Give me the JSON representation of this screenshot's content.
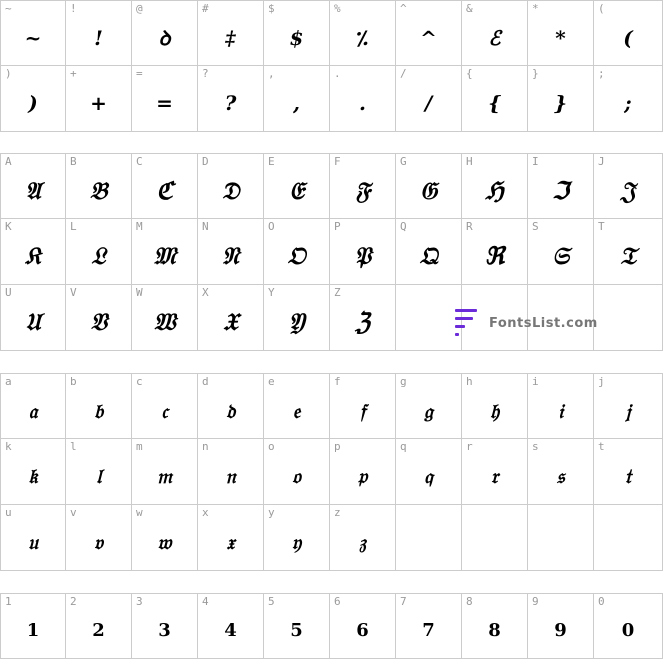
{
  "sections": [
    {
      "id": "symbols",
      "rows": [
        [
          {
            "k": "~",
            "g": "~"
          },
          {
            "k": "!",
            "g": "!"
          },
          {
            "k": "@",
            "g": "ꝺ"
          },
          {
            "k": "#",
            "g": "‡"
          },
          {
            "k": "$",
            "g": "$"
          },
          {
            "k": "%",
            "g": "⁒"
          },
          {
            "k": "^",
            "g": "^"
          },
          {
            "k": "&",
            "g": "ℰ"
          },
          {
            "k": "*",
            "g": "*"
          },
          {
            "k": "(",
            "g": "("
          }
        ],
        [
          {
            "k": ")",
            "g": ")"
          },
          {
            "k": "+",
            "g": "+"
          },
          {
            "k": "=",
            "g": "="
          },
          {
            "k": "?",
            "g": "?"
          },
          {
            "k": ",",
            "g": ","
          },
          {
            "k": ".",
            "g": "."
          },
          {
            "k": "/",
            "g": "/"
          },
          {
            "k": "{",
            "g": "{"
          },
          {
            "k": "}",
            "g": "}"
          },
          {
            "k": ";",
            "g": ";"
          }
        ]
      ]
    },
    {
      "id": "uppercase",
      "rows": [
        [
          {
            "k": "A",
            "g": "𝔄"
          },
          {
            "k": "B",
            "g": "𝔅"
          },
          {
            "k": "C",
            "g": "ℭ"
          },
          {
            "k": "D",
            "g": "𝔇"
          },
          {
            "k": "E",
            "g": "𝔈"
          },
          {
            "k": "F",
            "g": "𝔉"
          },
          {
            "k": "G",
            "g": "𝔊"
          },
          {
            "k": "H",
            "g": "ℌ"
          },
          {
            "k": "I",
            "g": "ℑ"
          },
          {
            "k": "J",
            "g": "𝔍"
          }
        ],
        [
          {
            "k": "K",
            "g": "𝔎"
          },
          {
            "k": "L",
            "g": "𝔏"
          },
          {
            "k": "M",
            "g": "𝔐"
          },
          {
            "k": "N",
            "g": "𝔑"
          },
          {
            "k": "O",
            "g": "𝔒"
          },
          {
            "k": "P",
            "g": "𝔓"
          },
          {
            "k": "Q",
            "g": "𝔔"
          },
          {
            "k": "R",
            "g": "ℜ"
          },
          {
            "k": "S",
            "g": "𝔖"
          },
          {
            "k": "T",
            "g": "𝔗"
          }
        ],
        [
          {
            "k": "U",
            "g": "𝔘"
          },
          {
            "k": "V",
            "g": "𝔙"
          },
          {
            "k": "W",
            "g": "𝔚"
          },
          {
            "k": "X",
            "g": "𝔛"
          },
          {
            "k": "Y",
            "g": "𝔜"
          },
          {
            "k": "Z",
            "g": "ℨ"
          },
          {
            "k": "",
            "g": ""
          },
          {
            "k": "",
            "g": ""
          },
          {
            "k": "",
            "g": ""
          },
          {
            "k": "",
            "g": ""
          }
        ]
      ]
    },
    {
      "id": "lowercase",
      "rows": [
        [
          {
            "k": "a",
            "g": "𝔞"
          },
          {
            "k": "b",
            "g": "𝔟"
          },
          {
            "k": "c",
            "g": "𝔠"
          },
          {
            "k": "d",
            "g": "𝔡"
          },
          {
            "k": "e",
            "g": "𝔢"
          },
          {
            "k": "f",
            "g": "𝔣"
          },
          {
            "k": "g",
            "g": "𝔤"
          },
          {
            "k": "h",
            "g": "𝔥"
          },
          {
            "k": "i",
            "g": "𝔦"
          },
          {
            "k": "j",
            "g": "𝔧"
          }
        ],
        [
          {
            "k": "k",
            "g": "𝔨"
          },
          {
            "k": "l",
            "g": "𝔩"
          },
          {
            "k": "m",
            "g": "𝔪"
          },
          {
            "k": "n",
            "g": "𝔫"
          },
          {
            "k": "o",
            "g": "𝔬"
          },
          {
            "k": "p",
            "g": "𝔭"
          },
          {
            "k": "q",
            "g": "𝔮"
          },
          {
            "k": "r",
            "g": "𝔯"
          },
          {
            "k": "s",
            "g": "𝔰"
          },
          {
            "k": "t",
            "g": "𝔱"
          }
        ],
        [
          {
            "k": "u",
            "g": "𝔲"
          },
          {
            "k": "v",
            "g": "𝔳"
          },
          {
            "k": "w",
            "g": "𝔴"
          },
          {
            "k": "x",
            "g": "𝔵"
          },
          {
            "k": "y",
            "g": "𝔶"
          },
          {
            "k": "z",
            "g": "𝔷"
          },
          {
            "k": "",
            "g": ""
          },
          {
            "k": "",
            "g": ""
          },
          {
            "k": "",
            "g": ""
          },
          {
            "k": "",
            "g": ""
          }
        ]
      ]
    },
    {
      "id": "digits",
      "rows": [
        [
          {
            "k": "1",
            "g": "1"
          },
          {
            "k": "2",
            "g": "2"
          },
          {
            "k": "3",
            "g": "3"
          },
          {
            "k": "4",
            "g": "4"
          },
          {
            "k": "5",
            "g": "5"
          },
          {
            "k": "6",
            "g": "6"
          },
          {
            "k": "7",
            "g": "7"
          },
          {
            "k": "8",
            "g": "8"
          },
          {
            "k": "9",
            "g": "9"
          },
          {
            "k": "0",
            "g": "0"
          }
        ]
      ]
    }
  ],
  "watermark": {
    "text": "FontsList.com",
    "color": "#6b2bd9"
  }
}
